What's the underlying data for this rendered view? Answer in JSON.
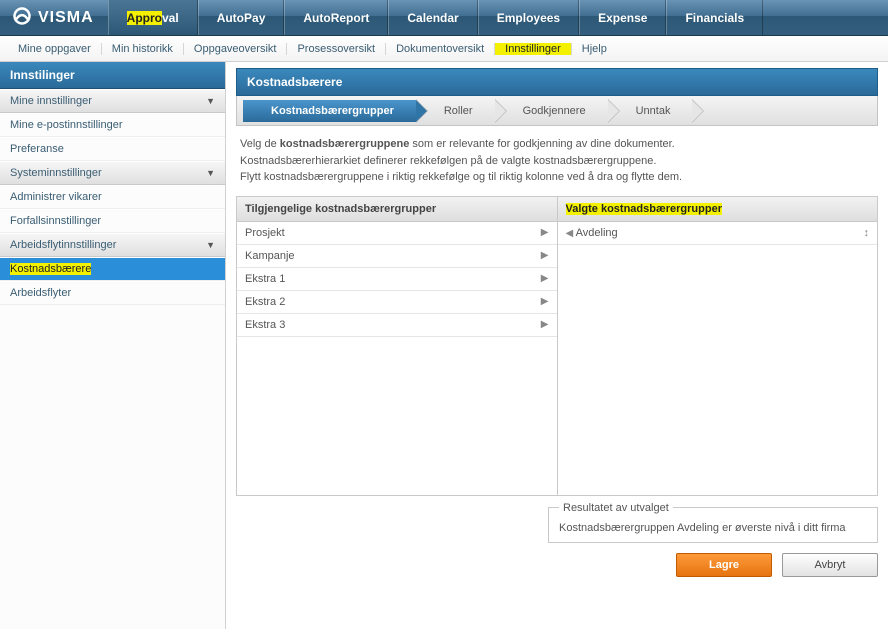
{
  "brand": {
    "name": "VISMA"
  },
  "topnav": {
    "items": [
      {
        "label": "Approval",
        "active": true,
        "hlPart": "Appro",
        "rest": "val"
      },
      {
        "label": "AutoPay"
      },
      {
        "label": "AutoReport"
      },
      {
        "label": "Calendar"
      },
      {
        "label": "Employees"
      },
      {
        "label": "Expense"
      },
      {
        "label": "Financials"
      }
    ]
  },
  "subnav": {
    "items": [
      {
        "label": "Mine oppgaver"
      },
      {
        "label": "Min historikk"
      },
      {
        "label": "Oppgaveoversikt"
      },
      {
        "label": "Prosessoversikt"
      },
      {
        "label": "Dokumentoversikt"
      },
      {
        "label": "Innstillinger",
        "highlight": true
      },
      {
        "label": "Hjelp"
      }
    ]
  },
  "sidebar": {
    "title": "Innstilinger",
    "groups": [
      {
        "header": "Mine innstillinger",
        "items": [
          {
            "label": "Mine e-postinnstillinger"
          },
          {
            "label": "Preferanse"
          }
        ]
      },
      {
        "header": "Systeminnstillinger",
        "items": [
          {
            "label": "Administrer vikarer"
          },
          {
            "label": "Forfallsinnstillinger"
          }
        ]
      },
      {
        "header": "Arbeidsflytinnstillinger",
        "items": [
          {
            "label": "Kostnadsbærere",
            "active": true,
            "highlight": true
          },
          {
            "label": "Arbeidsflyter"
          }
        ]
      }
    ]
  },
  "panel": {
    "title": "Kostnadsbærere"
  },
  "steps": [
    {
      "label": "Kostnadsbærergrupper",
      "active": true
    },
    {
      "label": "Roller"
    },
    {
      "label": "Godkjennere"
    },
    {
      "label": "Unntak"
    }
  ],
  "desc": {
    "l1a": "Velg de ",
    "l1b": "kostnadsbærergruppene",
    "l1c": " som er relevante for godkjenning av dine dokumenter.",
    "l2": "Kostnadsbærerhierarkiet definerer rekkefølgen på de valgte kostnadsbærergruppene.",
    "l3": "Flytt kostnadsbærergruppene i riktig rekkefølge og til riktig kolonne ved å dra og flytte dem."
  },
  "lists": {
    "availableHeader": "Tilgjengelige kostnadsbærergrupper",
    "selectedHeader": "Valgte kostnadsbærergrupper",
    "available": [
      {
        "label": "Prosjekt"
      },
      {
        "label": "Kampanje"
      },
      {
        "label": "Ekstra 1"
      },
      {
        "label": "Ekstra 2"
      },
      {
        "label": "Ekstra 3"
      }
    ],
    "selected": [
      {
        "label": "Avdeling"
      }
    ]
  },
  "result": {
    "legend": "Resultatet av utvalget",
    "text": "Kostnadsbærergruppen Avdeling er øverste nivå i ditt firma"
  },
  "buttons": {
    "save": "Lagre",
    "cancel": "Avbryt"
  }
}
